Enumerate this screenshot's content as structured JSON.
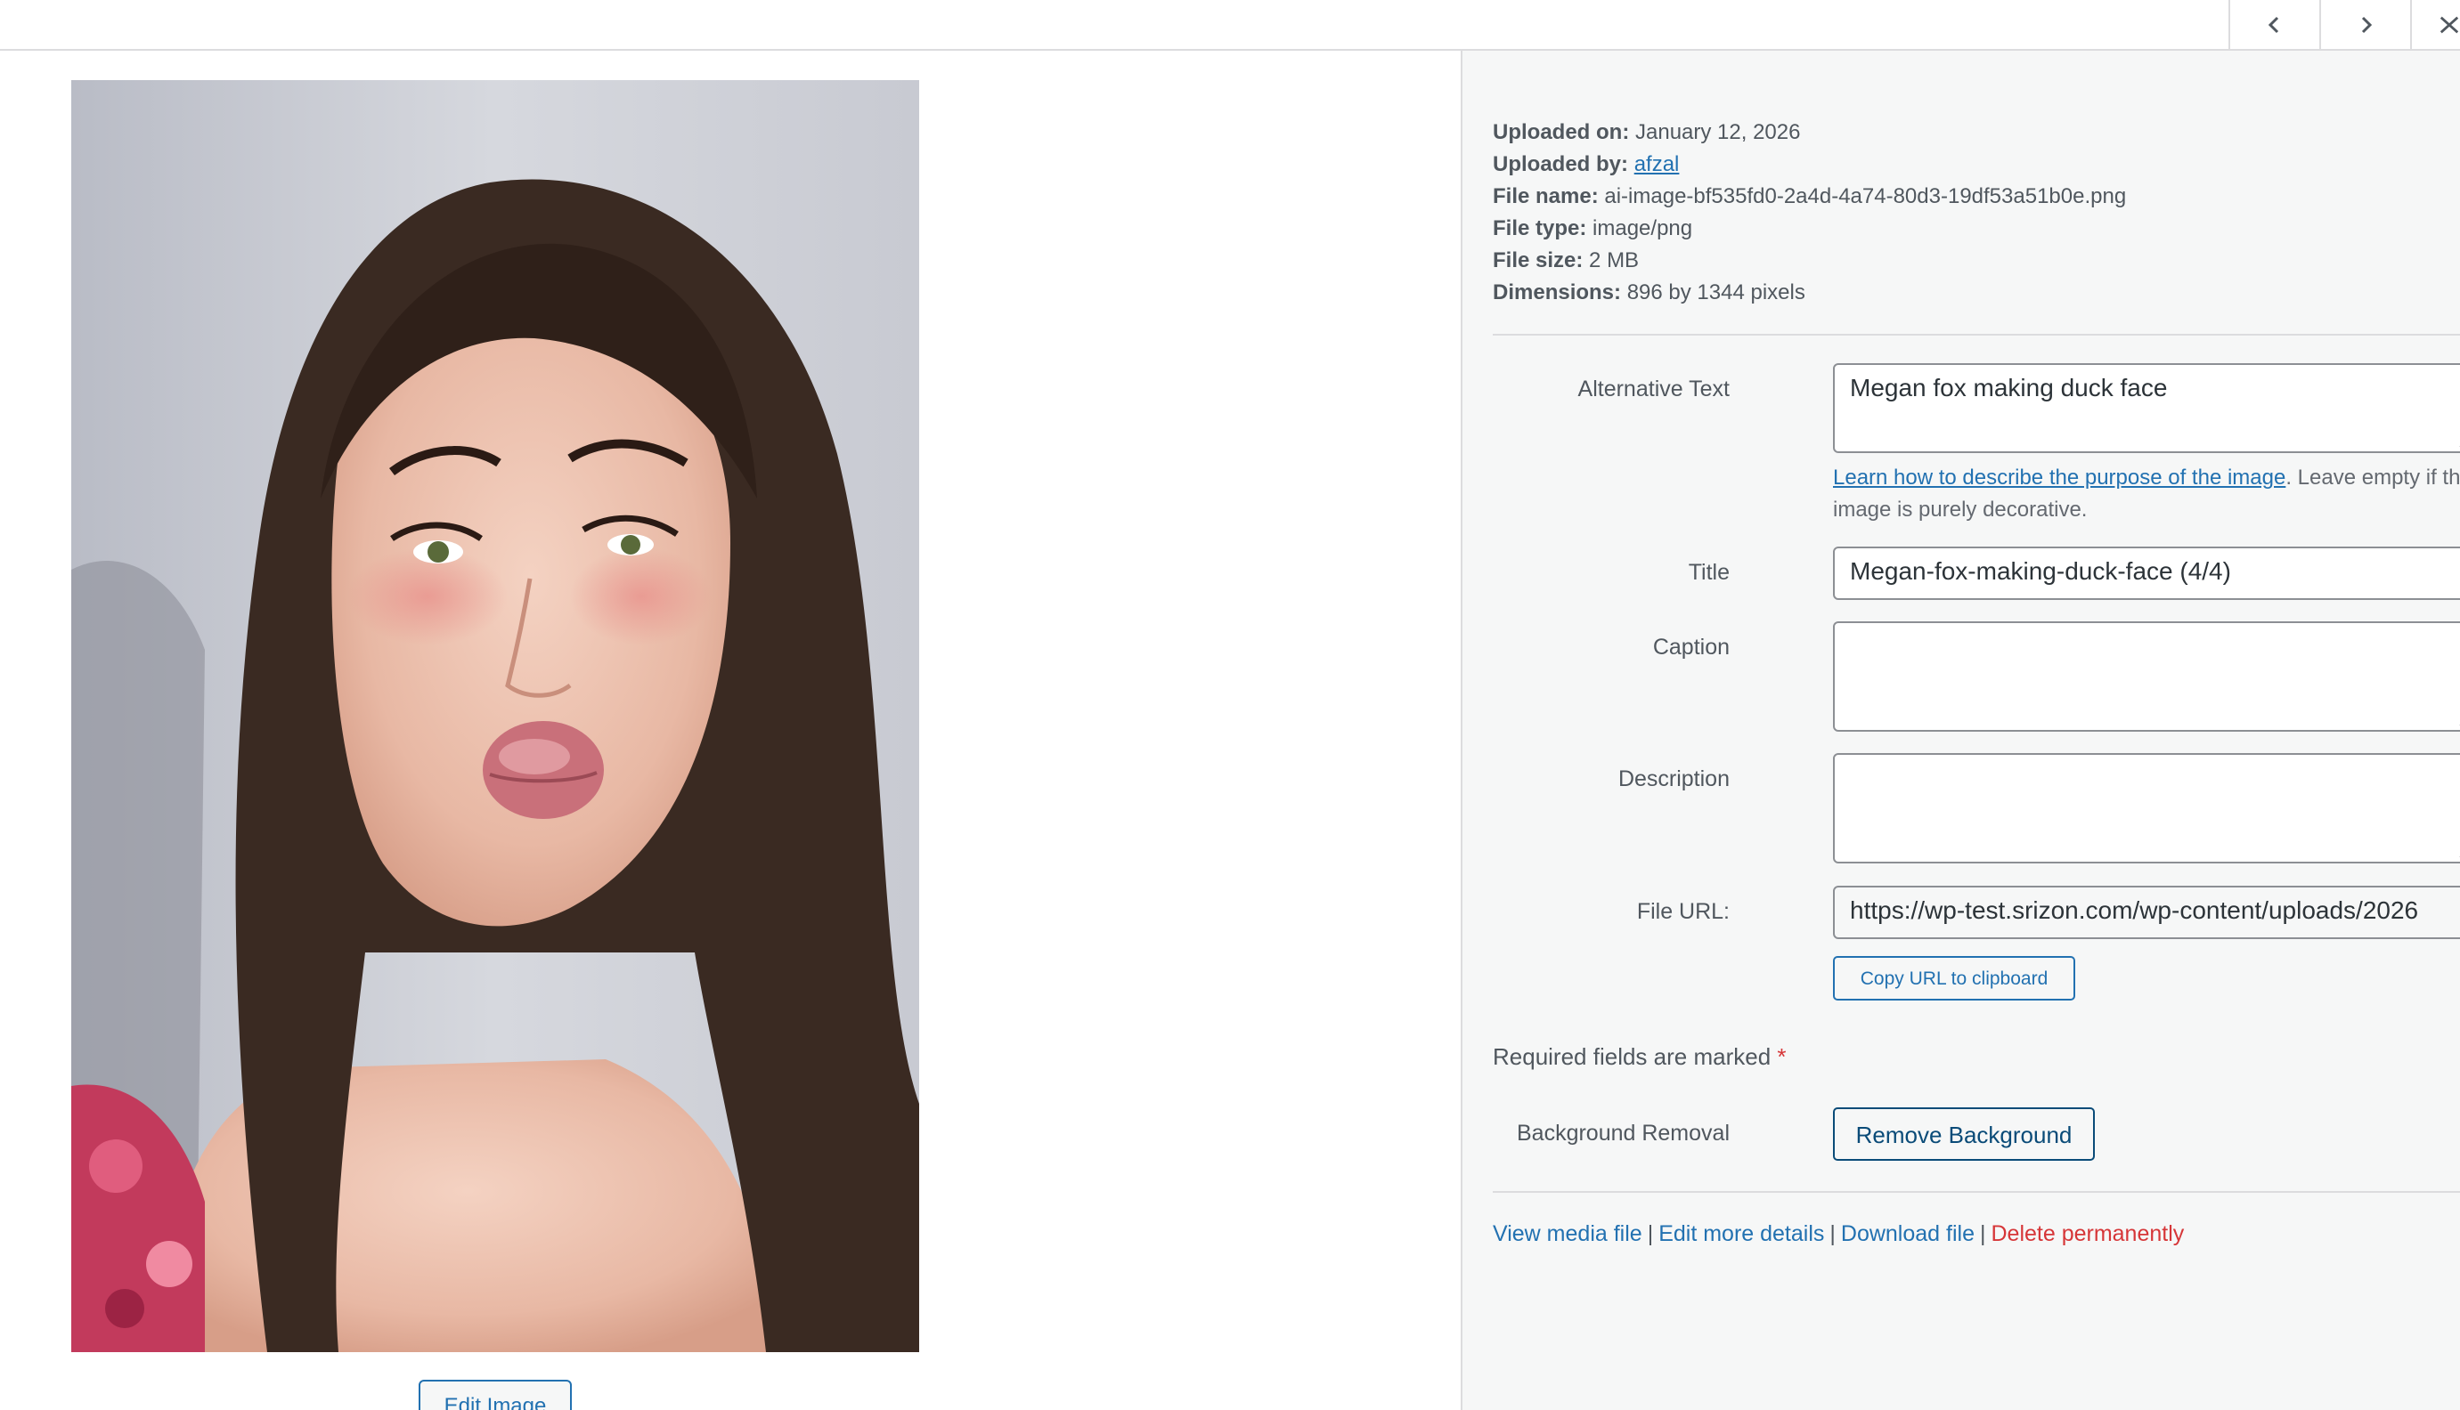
{
  "nav": {
    "prev_icon": "chevron-left-icon",
    "next_icon": "chevron-right-icon",
    "close_icon": "close-icon"
  },
  "preview": {
    "edit_image_label": "Edit Image"
  },
  "details": {
    "uploaded_on_label": "Uploaded on:",
    "uploaded_on_value": "January 12, 2026",
    "uploaded_by_label": "Uploaded by:",
    "uploaded_by_value": "afzal",
    "file_name_label": "File name:",
    "file_name_value": "ai-image-bf535fd0-2a4d-4a74-80d3-19df53a51b0e.png",
    "file_type_label": "File type:",
    "file_type_value": "image/png",
    "file_size_label": "File size:",
    "file_size_value": "2 MB",
    "dimensions_label": "Dimensions:",
    "dimensions_value": "896 by 1344 pixels"
  },
  "form": {
    "alt_label": "Alternative Text",
    "alt_value": "Megan fox making duck face",
    "alt_help_link": "Learn how to describe the purpose of the image",
    "alt_help_text": ". Leave empty if the image is purely decorative.",
    "title_label": "Title",
    "title_value": "Megan-fox-making-duck-face (4/4)",
    "caption_label": "Caption",
    "caption_value": "",
    "description_label": "Description",
    "description_value": "",
    "file_url_label": "File URL:",
    "file_url_value": "https://wp-test.srizon.com/wp-content/uploads/2026",
    "copy_url_label": "Copy URL to clipboard",
    "required_text": "Required fields are marked",
    "required_star": "*",
    "bg_removal_label": "Background Removal",
    "remove_bg_button": "Remove Background"
  },
  "actions": {
    "view_media": "View media file",
    "edit_details": "Edit more details",
    "download": "Download file",
    "delete": "Delete permanently",
    "separator": "|"
  },
  "colors": {
    "link": "#2271b1",
    "danger": "#d63638",
    "sidebar_bg": "#f6f7f7"
  }
}
